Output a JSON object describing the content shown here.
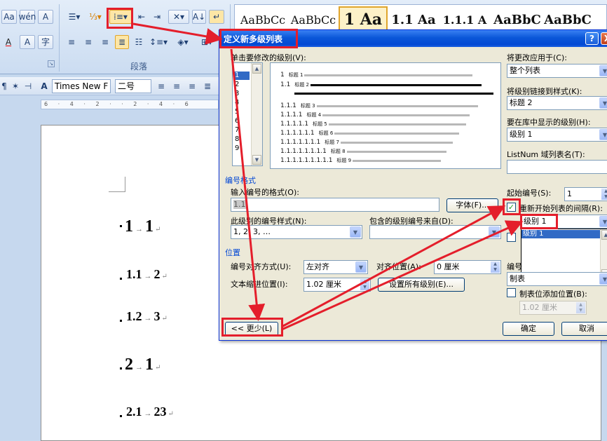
{
  "ribbon": {
    "group_paragraph": "段落",
    "font_name": "Times New F",
    "font_size": "二号",
    "styles": [
      {
        "label": "AaBbCc"
      },
      {
        "label": "AaBbCc"
      },
      {
        "label": "1 Aa"
      },
      {
        "label": "1.1 Aa"
      },
      {
        "label": "1.1.1 A"
      },
      {
        "label": "AaBbC"
      },
      {
        "label": "AaBbC"
      }
    ],
    "ruler_ticks": "6 · 4 · 2 · · 2 · 4 · 6"
  },
  "document": {
    "headings": [
      {
        "num": "1",
        "text": "1"
      },
      {
        "num": "1.1",
        "text": "2"
      },
      {
        "num": "1.2",
        "text": "3"
      },
      {
        "num": "2",
        "text": "1"
      },
      {
        "num": "2.1",
        "text": "23"
      }
    ]
  },
  "dialog": {
    "title": "定义新多级列表",
    "help_label": "?",
    "close_label": "X",
    "click_level_label": "单击要修改的级别(V):",
    "levels": [
      "1",
      "2",
      "3",
      "4",
      "5",
      "6",
      "7",
      "8",
      "9"
    ],
    "preview_rows": [
      {
        "num": "1",
        "text": "标题 1"
      },
      {
        "num": "1.1",
        "text": "标题 2"
      },
      {
        "num": "1.1.1",
        "text": "标题 3"
      },
      {
        "num": "1.1.1.1",
        "text": "标题 4"
      },
      {
        "num": "1.1.1.1.1",
        "text": "标题 5"
      },
      {
        "num": "1.1.1.1.1.1",
        "text": "标题 6"
      },
      {
        "num": "1.1.1.1.1.1.1",
        "text": "标题 7"
      },
      {
        "num": "1.1.1.1.1.1.1.1",
        "text": "标题 8"
      },
      {
        "num": "1.1.1.1.1.1.1.1.1",
        "text": "标题 9"
      }
    ],
    "apply_to_label": "将更改应用于(C):",
    "apply_to_value": "整个列表",
    "link_style_label": "将级别链接到样式(K):",
    "link_style_value": "标题 2",
    "gallery_level_label": "要在库中显示的级别(H):",
    "gallery_level_value": "级别 1",
    "listnum_label": "ListNum 域列表名(T):",
    "listnum_value": "",
    "number_format_section": "编号格式",
    "enter_format_label": "输入编号的格式(O):",
    "enter_format_value": "1.1",
    "font_button": "字体(F)...",
    "start_at_label": "起始编号(S):",
    "start_at_value": "1",
    "restart_label": "重新开始列表的间隔(R):",
    "restart_value": "级别 1",
    "restart_options": [
      "级别 1"
    ],
    "number_style_label": "此级别的编号样式(N):",
    "number_style_value": "1, 2, 3, …",
    "include_level_label": "包含的级别编号来自(D):",
    "include_level_value": "",
    "position_section": "位置",
    "alignment_label": "编号对齐方式(U):",
    "alignment_value": "左对齐",
    "aligned_at_label": "对齐位置(A):",
    "aligned_at_value": "0 厘米",
    "indent_label": "文本缩进位置(I):",
    "indent_value": "1.02 厘米",
    "set_all_levels_button": "设置所有级别(E)...",
    "follow_label": "编号",
    "follow_value": "制表",
    "add_tab_label": "制表位添加位置(B):",
    "add_tab_value": "1.02 厘米",
    "less_button": "<< 更少(L)",
    "ok_button": "确定",
    "cancel_button": "取消"
  }
}
